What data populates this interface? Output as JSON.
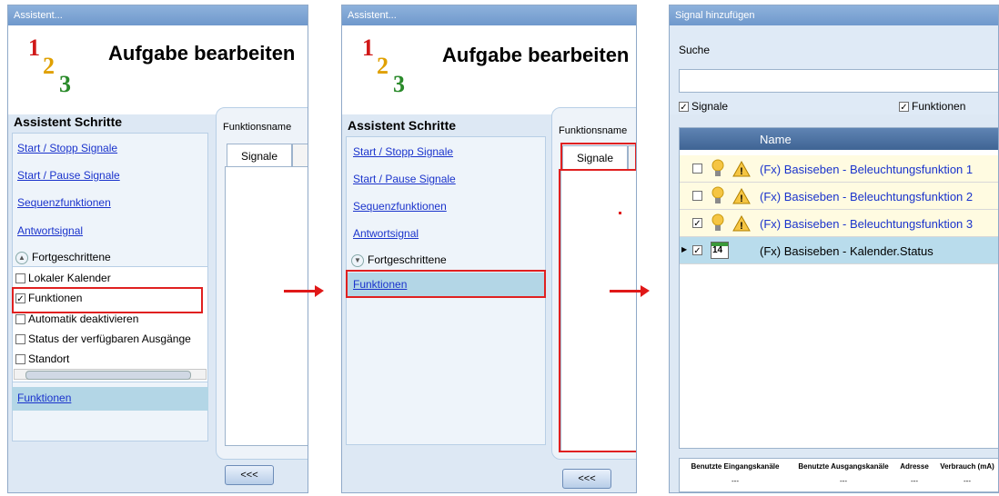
{
  "arrow_color": "#e01818",
  "panel1": {
    "title": "Assistent...",
    "numbers": [
      "1",
      "2",
      "3"
    ],
    "page_title": "Aufgabe bearbeiten",
    "steps_title": "Assistent Schritte",
    "steps": [
      "Start / Stopp Signale",
      "Start / Pause Signale",
      "Sequenzfunktionen",
      "Antwortsignal"
    ],
    "advanced_label": "Fortgeschrittene",
    "advanced_items": [
      {
        "label": "Lokaler Kalender",
        "checked": ""
      },
      {
        "label": "Funktionen",
        "checked": "✓"
      },
      {
        "label": "Automatik deaktivieren",
        "checked": ""
      },
      {
        "label": "Status der verfügbaren Ausgänge",
        "checked": ""
      },
      {
        "label": "Standort",
        "checked": ""
      }
    ],
    "selected_step": "Funktionen",
    "function_name_label": "Funktionsname",
    "tab_label": "Signale",
    "back_button": "<<<"
  },
  "panel2": {
    "title": "Assistent...",
    "numbers": [
      "1",
      "2",
      "3"
    ],
    "page_title": "Aufgabe bearbeiten",
    "steps_title": "Assistent Schritte",
    "steps": [
      "Start / Stopp Signale",
      "Start / Pause Signale",
      "Sequenzfunktionen",
      "Antwortsignal"
    ],
    "advanced_label": "Fortgeschrittene",
    "selected_step": "Funktionen",
    "function_name_label": "Funktionsname",
    "tab_label": "Signale",
    "back_button": "<<<"
  },
  "panel3": {
    "title": "Signal hinzufügen",
    "search_label": "Suche",
    "search_value": "",
    "filter_signals": "Signale",
    "filter_functions": "Funktionen",
    "column_name": "Name",
    "rows": [
      {
        "name": "(Fx) Basiseben - Beleuchtungsfunktion 1",
        "checked": "",
        "icon": "bulb-icon",
        "warning": "warning-icon"
      },
      {
        "name": "(Fx) Basiseben - Beleuchtungsfunktion 2",
        "checked": "",
        "icon": "bulb-icon",
        "warning": "warning-icon"
      },
      {
        "name": "(Fx) Basiseben - Beleuchtungsfunktion 3",
        "checked": "✓",
        "icon": "bulb-icon",
        "warning": "warning-icon"
      },
      {
        "name": "(Fx) Basiseben - Kalender.Status",
        "checked": "✓",
        "icon": "calendar-icon",
        "calendar_day": "14"
      }
    ],
    "footer_headers": [
      "Benutzte Eingangskanäle",
      "Benutzte Ausgangskanäle",
      "Adresse",
      "Verbrauch (mA)"
    ],
    "footer_values": [
      "---",
      "---",
      "---",
      "---"
    ]
  }
}
